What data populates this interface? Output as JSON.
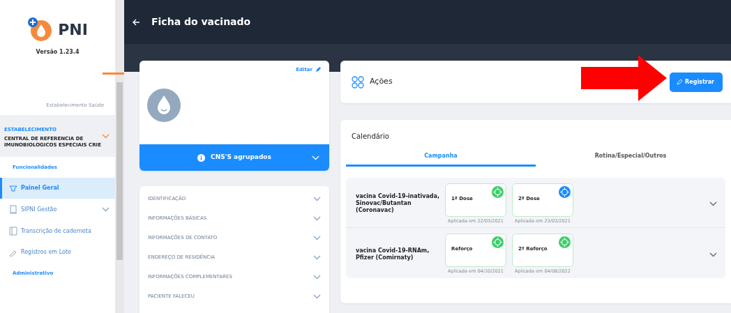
{
  "sidebar": {
    "logo": "PNI",
    "version": "Versão 1.23.4",
    "partial_item": "Estabelecimento Saúde",
    "establishment": {
      "label": "ESTABELECIMENTO",
      "name": "CENTRAL DE REFERENCIA DE IMUNOBIOLOGICOS ESPECIAIS CRIE"
    },
    "items": [
      {
        "kind": "heading",
        "label": "Funcionalidades"
      },
      {
        "kind": "item",
        "label": "Painel Geral",
        "selected": true,
        "expandable": false
      },
      {
        "kind": "item",
        "label": "SIPNI Gestão",
        "selected": false,
        "expandable": true
      },
      {
        "kind": "item",
        "label": "Transcrição de caderneta",
        "selected": false,
        "expandable": false
      },
      {
        "kind": "item",
        "label": "Registros em Lote",
        "selected": false,
        "expandable": false
      },
      {
        "kind": "heading",
        "label": "Administrativo"
      }
    ]
  },
  "header": {
    "title": "Ficha do vacinado"
  },
  "profile": {
    "edit_link": "Editar",
    "cns_button": "CNS'S agrupados"
  },
  "sections": [
    "IDENTIFICAÇÃO",
    "INFORMAÇÕES BÁSICAS",
    "INFORMAÇÕES DE CONTATO",
    "ENDEREÇO DE RESIDÊNCIA",
    "INFORMAÇÕES COMPLEMENTARES",
    "PACIENTE FALECEU"
  ],
  "actions": {
    "title": "Ações",
    "register_button": "Registrar"
  },
  "calendar": {
    "title": "Calendário",
    "tabs": [
      {
        "label": "Campanha",
        "selected": true
      },
      {
        "label": "Rotina/Especial/Outros",
        "selected": false
      }
    ],
    "vaccines": [
      {
        "name": "vacina Covid-19-inativada, Sinovac/Butantan (Coronavac)",
        "doses": [
          {
            "label": "1ª Dose",
            "applied": "Aplicada em 22/03/2021",
            "color": "#3ccf6a"
          },
          {
            "label": "2ª Dose",
            "applied": "Aplicada em 23/03/2021",
            "color": "#1a8cff"
          }
        ]
      },
      {
        "name": "vacina Covid-19-RNAm, Pfizer (Comirnaty)",
        "doses": [
          {
            "label": "Reforço",
            "applied": "Aplicada em 04/10/2021",
            "color": "#3ccf6a"
          },
          {
            "label": "2º Reforço",
            "applied": "Aplicada em 04/08/2022",
            "color": "#3ccf6a"
          }
        ]
      }
    ]
  }
}
